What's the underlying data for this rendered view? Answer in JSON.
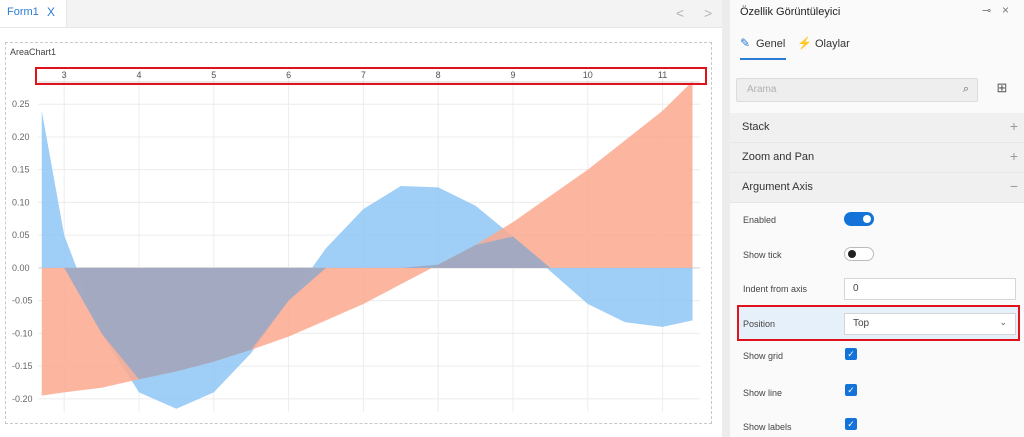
{
  "designer": {
    "tab_label": "Form1",
    "tab_close": "X",
    "nav_prev": "<",
    "nav_next": ">",
    "chart_name": "AreaChart1"
  },
  "chart_data": {
    "type": "area",
    "x": [
      2.7,
      3,
      3.5,
      4,
      4.5,
      5,
      5.5,
      6,
      6.5,
      7,
      7.5,
      8,
      8.5,
      9,
      9.5,
      10,
      10.5,
      11,
      11.4
    ],
    "series": [
      {
        "values": [
          0.24,
          0.05,
          -0.1,
          -0.19,
          -0.215,
          -0.19,
          -0.13,
          -0.05,
          0.03,
          0.09,
          0.125,
          0.123,
          0.095,
          0.048,
          -0.005,
          -0.055,
          -0.083,
          -0.09,
          -0.08
        ]
      },
      {
        "values": [
          -0.195,
          -0.19,
          -0.183,
          -0.17,
          -0.158,
          -0.143,
          -0.125,
          -0.105,
          -0.08,
          -0.055,
          -0.025,
          0.005,
          0.035,
          0.07,
          0.11,
          0.15,
          0.195,
          0.24,
          0.285
        ]
      }
    ],
    "colors": [
      "#8ec5f5",
      "#fba98e"
    ],
    "overlap_color": "#9aa8c4",
    "x_ticks": [
      "3",
      "4",
      "5",
      "6",
      "7",
      "8",
      "9",
      "10",
      "11"
    ],
    "y_ticks": [
      "0.25",
      "0.20",
      "0.15",
      "0.10",
      "0.05",
      "0.00",
      "-0.05",
      "-0.10",
      "-0.15",
      "-0.20"
    ],
    "x_axis_position": "top",
    "xlim": [
      2.65,
      11.5
    ],
    "ylim": [
      -0.22,
      0.29
    ],
    "grid": true
  },
  "panel": {
    "title": "Özellik Görüntüleyici",
    "pin_icon": "⊸",
    "close_icon": "×",
    "tab_general": "Genel",
    "tab_events": "Olaylar",
    "search_placeholder": "Arama",
    "sections": [
      {
        "label": "Stack",
        "icon": "+"
      },
      {
        "label": "Zoom and Pan",
        "icon": "+"
      },
      {
        "label": "Argument Axis",
        "icon": "−"
      }
    ],
    "props": {
      "enabled": "Enabled",
      "show_tick": "Show tick",
      "indent_from_axis": "Indent from axis",
      "indent_value": "0",
      "position": "Position",
      "position_value": "Top",
      "show_grid": "Show grid",
      "show_line": "Show line",
      "show_labels": "Show labels"
    }
  }
}
